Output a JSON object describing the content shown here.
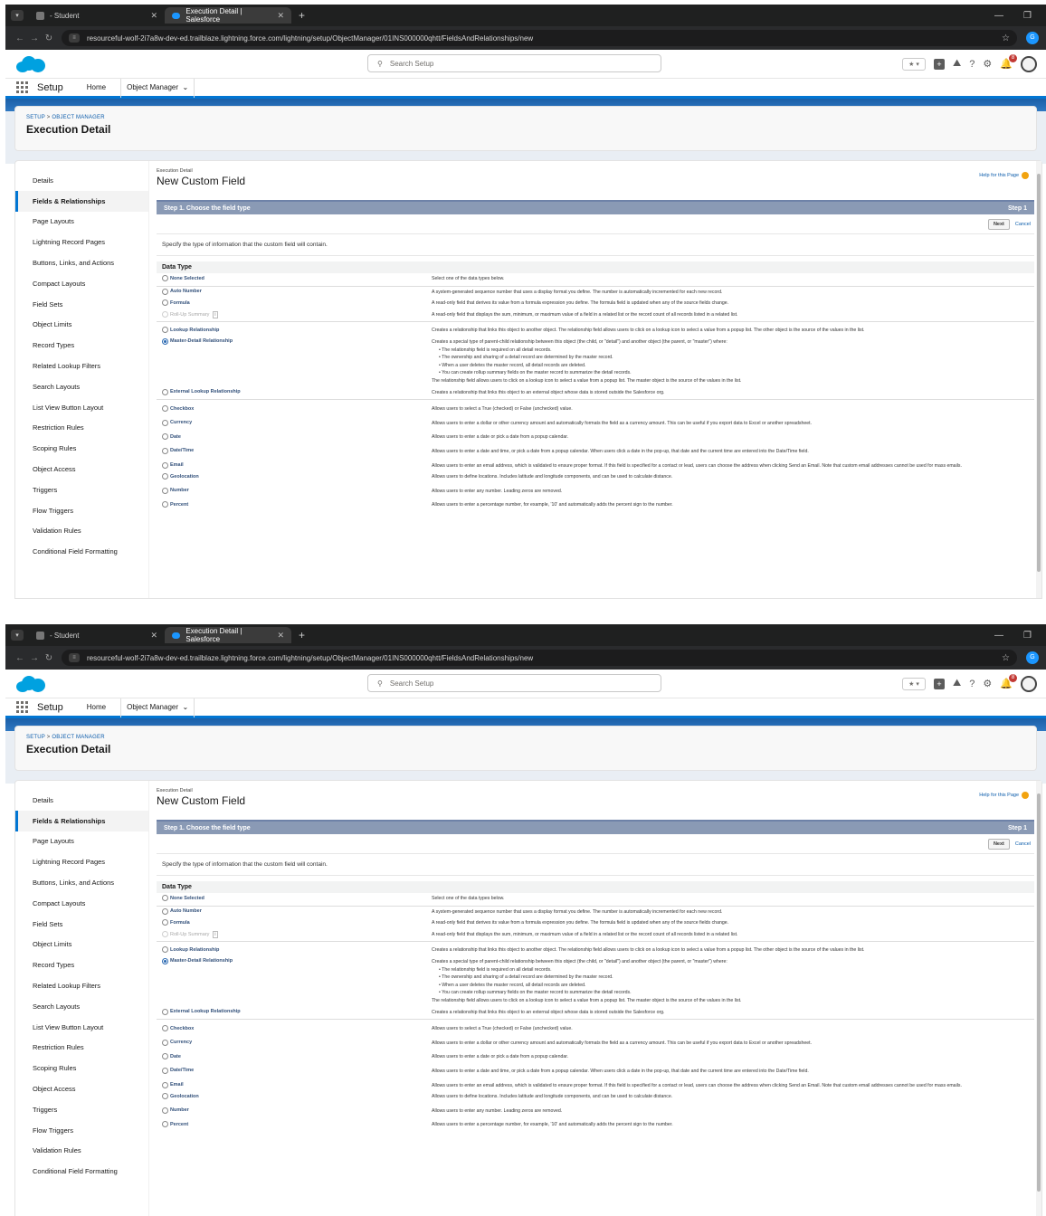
{
  "browser": {
    "tab1": "- Student",
    "tab2": "Execution Detail | Salesforce",
    "url": "resourceful-wolf-2i7a8w-dev-ed.trailblaze.lightning.force.com/lightning/setup/ObjectManager/01INS000000qhtt/FieldsAndRelationships/new",
    "profile_initial": "G"
  },
  "header": {
    "search_placeholder": "Search Setup",
    "notif_count": "8"
  },
  "appnav": {
    "app_name": "Setup",
    "home": "Home",
    "object_manager": "Object Manager"
  },
  "banner": {
    "crumb1": "SETUP",
    "crumb_sep": ">",
    "crumb2": "OBJECT MANAGER",
    "object_title": "Execution Detail"
  },
  "sidebar": {
    "items": [
      "Details",
      "Fields & Relationships",
      "Page Layouts",
      "Lightning Record Pages",
      "Buttons, Links, and Actions",
      "Compact Layouts",
      "Field Sets",
      "Object Limits",
      "Record Types",
      "Related Lookup Filters",
      "Search Layouts",
      "List View Button Layout",
      "Restriction Rules",
      "Scoping Rules",
      "Object Access",
      "Triggers",
      "Flow Triggers",
      "Validation Rules",
      "Conditional Field Formatting"
    ]
  },
  "main": {
    "subtitle": "Execution Detail",
    "title": "New Custom Field",
    "help": "Help for this Page",
    "step_title": "Step 1. Choose the field type",
    "step_right": "Step 1",
    "next": "Next",
    "cancel": "Cancel",
    "instructions": "Specify the type of information that the custom field will contain.",
    "data_type_header": "Data Type",
    "info_badge": "i"
  },
  "types": {
    "none": {
      "label": "None Selected",
      "desc": "Select one of the data types below."
    },
    "auto": {
      "label": "Auto Number",
      "desc": "A system-generated sequence number that uses a display format you define. The number is automatically incremented for each new record."
    },
    "formula": {
      "label": "Formula",
      "desc": "A read-only field that derives its value from a formula expression you define. The formula field is updated when any of the source fields change."
    },
    "rollup": {
      "label": "Roll-Up Summary",
      "desc": "A read-only field that displays the sum, minimum, or maximum value of a field in a related list or the record count of all records listed in a related list."
    },
    "lookup": {
      "label": "Lookup Relationship",
      "desc": "Creates a relationship that links this object to another object. The relationship field allows users to click on a lookup icon to select a value from a popup list. The other object is the source of the values in the list."
    },
    "md": {
      "label": "Master-Detail Relationship",
      "desc": "Creates a special type of parent-child relationship between this object (the child, or \"detail\") and another object (the parent, or \"master\") where:",
      "b1": "The relationship field is required on all detail records.",
      "b2": "The ownership and sharing of a detail record are determined by the master record.",
      "b3": "When a user deletes the master record, all detail records are deleted.",
      "b4": "You can create rollup summary fields on the master record to summarize the detail records.",
      "tail": "The relationship field allows users to click on a lookup icon to select a value from a popup list. The master object is the source of the values in the list."
    },
    "ext": {
      "label": "External Lookup Relationship",
      "desc": "Creates a relationship that links this object to an external object whose data is stored outside the Salesforce org."
    },
    "checkbox": {
      "label": "Checkbox",
      "desc": "Allows users to select a True (checked) or False (unchecked) value."
    },
    "currency": {
      "label": "Currency",
      "desc": "Allows users to enter a dollar or other currency amount and automatically formats the field as a currency amount. This can be useful if you export data to Excel or another spreadsheet."
    },
    "date": {
      "label": "Date",
      "desc": "Allows users to enter a date or pick a date from a popup calendar."
    },
    "datetime": {
      "label": "Date/Time",
      "desc": "Allows users to enter a date and time, or pick a date from a popup calendar. When users click a date in the pop-up, that date and the current time are entered into the Date/Time field."
    },
    "email": {
      "label": "Email",
      "desc": "Allows users to enter an email address, which is validated to ensure proper format. If this field is specified for a contact or lead, users can choose the address when clicking Send an Email. Note that custom email addresses cannot be used for mass emails."
    },
    "geo": {
      "label": "Geolocation",
      "desc": "Allows users to define locations. Includes latitude and longitude components, and can be used to calculate distance."
    },
    "number": {
      "label": "Number",
      "desc": "Allows users to enter any number. Leading zeros are removed."
    },
    "percent": {
      "label": "Percent",
      "desc": "Allows users to enter a percentage number, for example, '10' and automatically adds the percent sign to the number."
    }
  },
  "colors": {
    "brand": "#0176d3",
    "banner": "#1b5fa7",
    "step_bar": "#8a9ab5"
  }
}
